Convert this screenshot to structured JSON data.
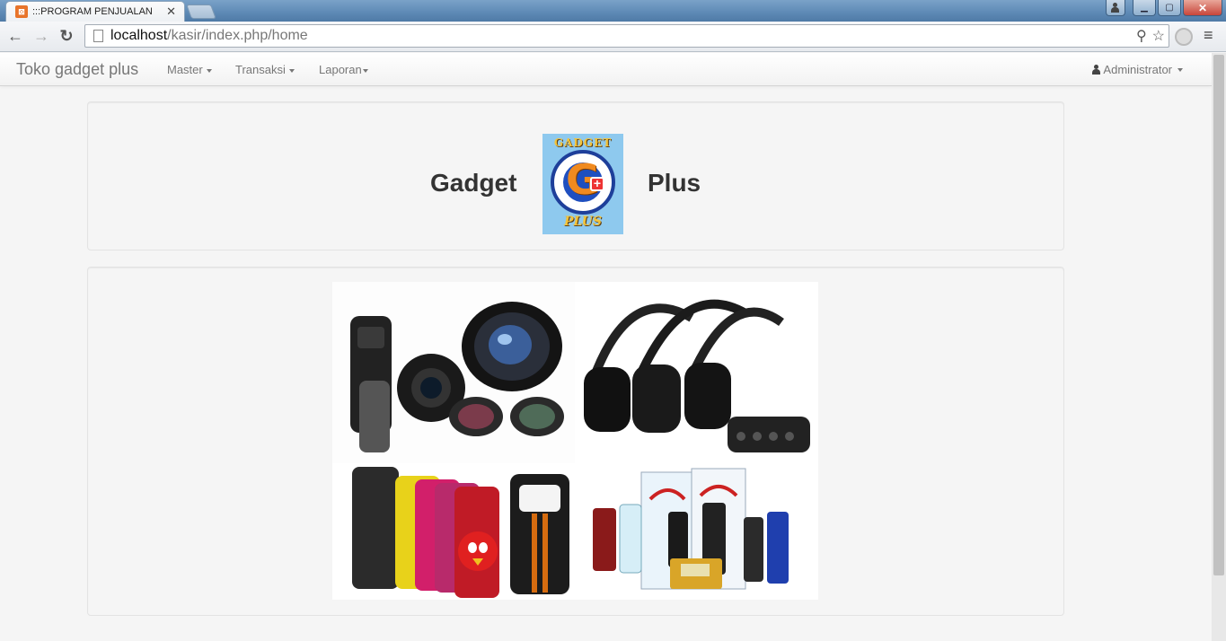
{
  "browser": {
    "tab_title": ":::PROGRAM PENJUALAN",
    "tab_close": "✕",
    "url_host": "localhost",
    "url_path": "/kasir/index.php/home",
    "back_glyph": "←",
    "forward_glyph": "→",
    "reload_glyph": "↻",
    "menu_glyph": "≡",
    "zoom_glyph": "⚲",
    "star_glyph": "☆",
    "min_glyph": "▁",
    "max_glyph": "▢",
    "close_glyph": "✕",
    "icons": [
      "back-icon",
      "forward-icon",
      "reload-icon",
      "page-icon",
      "search-icon",
      "star-icon",
      "extension-icon",
      "menu-icon"
    ]
  },
  "navbar": {
    "brand": "Toko gadget plus",
    "items": [
      {
        "label": "Master"
      },
      {
        "label": "Transaksi"
      },
      {
        "label": "Laporan"
      }
    ],
    "user": "Administrator"
  },
  "hero": {
    "left_word": "Gadget",
    "right_word": "Plus",
    "logo_top_text": "GADGET",
    "logo_letter": "G",
    "logo_plus": "+",
    "logo_bottom_text": "PLUS"
  },
  "collage": {
    "images": [
      "camera-lens-kit-image",
      "wireless-headphones-image",
      "phone-cases-image",
      "power-bank-image"
    ]
  },
  "colors": {
    "navbar_bg": "#f8f8f8",
    "page_bg": "#f5f5f5",
    "logo_bg": "#8ec9ee",
    "accent_orange": "#f08a1f",
    "ring_blue": "#1e3f9a"
  }
}
